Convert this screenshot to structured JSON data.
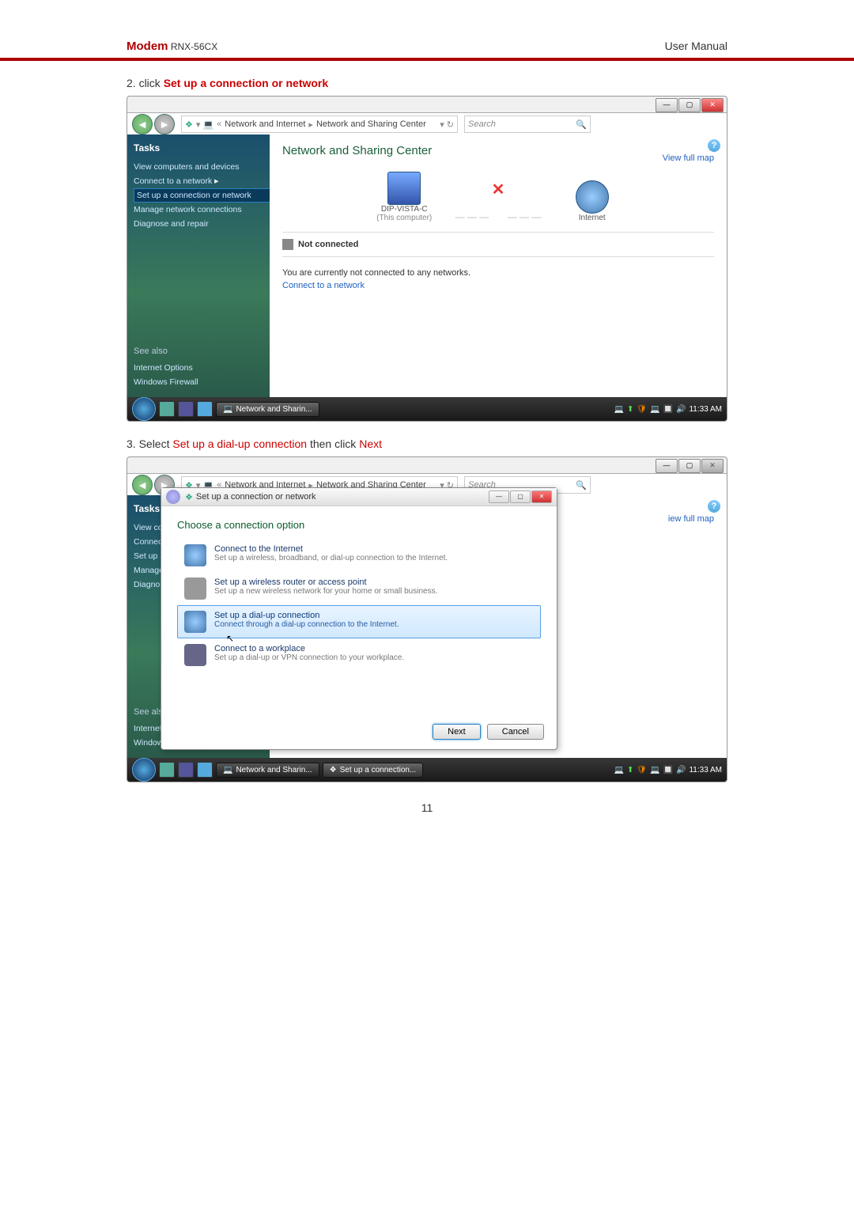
{
  "header": {
    "brand": "Modem",
    "model": "RNX-56CX",
    "right": "User Manual"
  },
  "step2": {
    "num": "2. click ",
    "action": "Set up a connection or network"
  },
  "step3": {
    "prefix": "3. Select ",
    "action1": "Set up a dial-up connection",
    "mid": " then click ",
    "action2": "Next"
  },
  "breadcrumb": {
    "prefix": "«",
    "p1": "Network and Internet",
    "p2": "Network and Sharing Center"
  },
  "search": {
    "placeholder": "Search"
  },
  "tasks": {
    "title": "Tasks",
    "items": [
      "View computers and devices",
      "Connect to a network",
      "Set up a connection or network",
      "Manage network connections",
      "Diagnose and repair"
    ],
    "seealso": "See also",
    "links": [
      "Internet Options",
      "Windows Firewall"
    ]
  },
  "content1": {
    "title": "Network and Sharing Center",
    "viewmap": "View full map",
    "pcname": "DIP-VISTA-C",
    "thispc": "(This computer)",
    "internet": "Internet",
    "notconn": "Not connected",
    "msg": "You are currently not connected to any networks.",
    "connectlink": "Connect to a network"
  },
  "taskbar": {
    "app1": "Network and Sharin...",
    "app2": "Set up a connection...",
    "time": "11:33 AM"
  },
  "wizard": {
    "title": "Set up a connection or network",
    "heading": "Choose a connection option",
    "options": [
      {
        "t": "Connect to the Internet",
        "s": "Set up a wireless, broadband, or dial-up connection to the Internet."
      },
      {
        "t": "Set up a wireless router or access point",
        "s": "Set up a new wireless network for your home or small business."
      },
      {
        "t": "Set up a dial-up connection",
        "s": "Connect through a dial-up connection to the Internet."
      },
      {
        "t": "Connect to a workplace",
        "s": "Set up a dial-up or VPN connection to your workplace."
      }
    ],
    "next": "Next",
    "cancel": "Cancel"
  },
  "content2": {
    "viewmap": "iew full map"
  },
  "page_number": "11"
}
